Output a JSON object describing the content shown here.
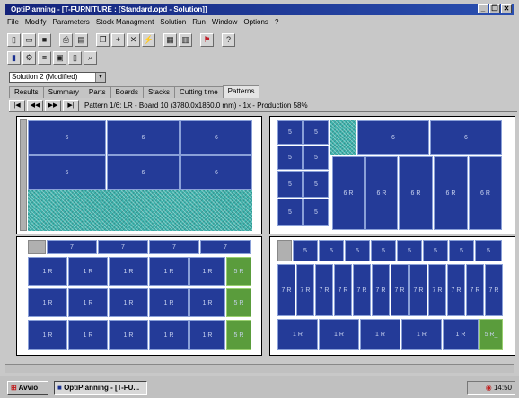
{
  "window": {
    "title": "OptiPlanning - [T-FURNITURE : [Standard.opd - Solution]]",
    "buttons": [
      "_",
      "❐",
      "✕"
    ]
  },
  "menu": [
    "File",
    "Modify",
    "Parameters",
    "Stock Managment",
    "Solution",
    "Run",
    "Window",
    "Options",
    "?"
  ],
  "toolbar1_icons": [
    "new-icon",
    "open-icon",
    "save-icon",
    "print-icon",
    "preview-icon",
    "copy-icon",
    "add-icon",
    "delete-icon",
    "run-icon",
    "calc-icon",
    "report-icon",
    "flag-icon",
    "help-icon"
  ],
  "toolbar2_icons": [
    "book-icon",
    "gear-icon",
    "stack-icon",
    "sheet-icon",
    "file-icon",
    "zoom-icon"
  ],
  "solution_select": "Solution 2 (Modified)",
  "tabs": [
    "Results",
    "Summary",
    "Parts",
    "Boards",
    "Stacks",
    "Cutting time",
    "Patterns"
  ],
  "active_tab": "Patterns",
  "nav_buttons": [
    "|◀",
    "◀◀",
    "▶▶",
    "▶|"
  ],
  "pattern_info": "Pattern 1/6: LR - Board 10 (3780.0x1860.0 mm) - 1x - Production 58%",
  "labels": {
    "p6": "6",
    "p5": "5",
    "p7": "7",
    "p6r": "6 R",
    "p7r": "7 R",
    "p1r": "1 R",
    "p5r": "5 R",
    "p5r2": "5 R_"
  },
  "taskbar": {
    "start": "Avvio",
    "task": "OptiPlanning - [T-FU...",
    "clock": "14:50"
  }
}
